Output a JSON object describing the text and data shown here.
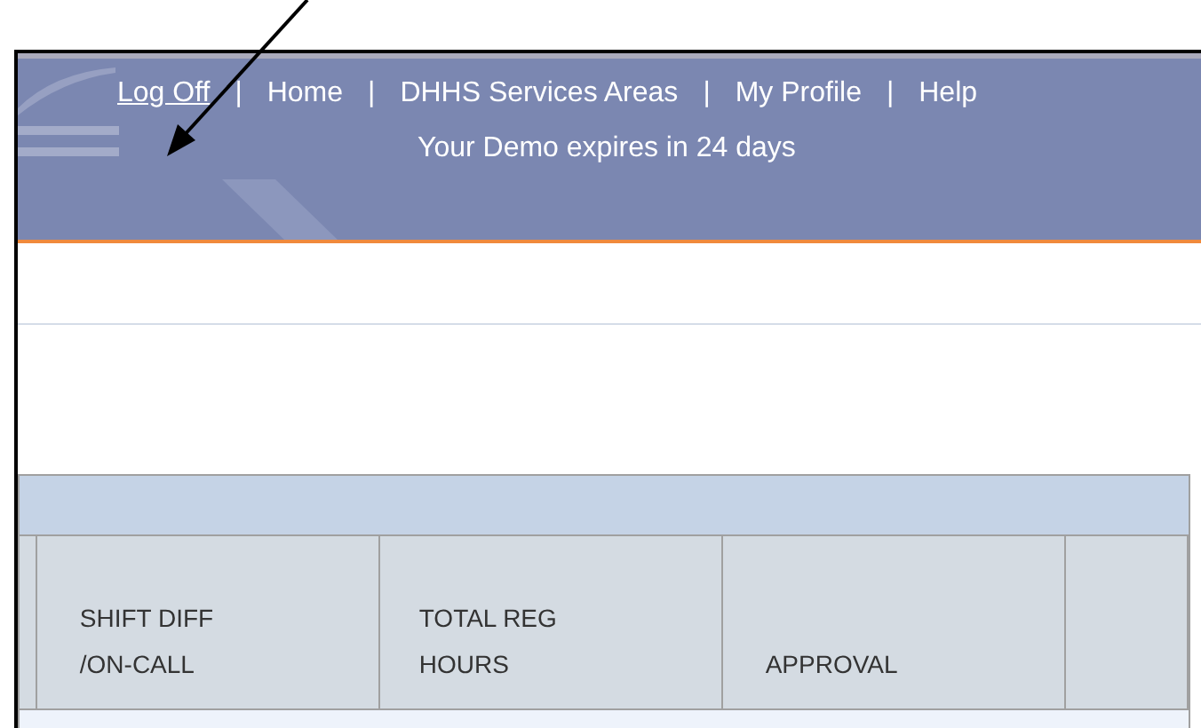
{
  "header": {
    "nav": [
      {
        "kind": "link",
        "label": "Log Off",
        "underlined": true
      },
      {
        "kind": "separator",
        "label": "|"
      },
      {
        "kind": "link",
        "label": "Home",
        "underlined": false
      },
      {
        "kind": "separator",
        "label": "|"
      },
      {
        "kind": "link",
        "label": "DHHS Services Areas",
        "underlined": false
      },
      {
        "kind": "separator",
        "label": "|"
      },
      {
        "kind": "link",
        "label": "My Profile",
        "underlined": false
      },
      {
        "kind": "separator",
        "label": "|"
      },
      {
        "kind": "link",
        "label": "Help",
        "underlined": false
      }
    ],
    "notice": "Your Demo expires in 24 days"
  },
  "table": {
    "columns": [
      "SHIFT DIFF\n/ON-CALL",
      "TOTAL REG\nHOURS",
      "APPROVAL"
    ]
  }
}
